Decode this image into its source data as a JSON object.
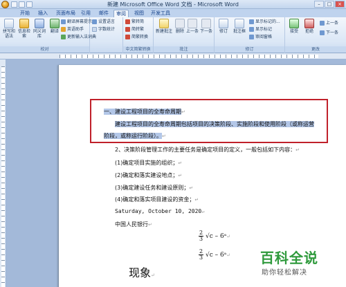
{
  "window": {
    "title": "新建 Microsoft Office Word 文档 - Microsoft Word",
    "min": "–",
    "max": "□",
    "close": "×"
  },
  "tabs": [
    "开始",
    "插入",
    "页面布局",
    "引用",
    "邮件",
    "审阅",
    "视图",
    "开发工具"
  ],
  "active_tab": "审阅",
  "ribbon": {
    "proofing": {
      "label": "校对",
      "spelling": "拼写和语法",
      "research": "信息检索",
      "thesaurus": "同义词库",
      "translate": "翻译",
      "small": [
        "翻译屏幕提示",
        "英语助手",
        "更新输入法词典"
      ]
    },
    "wordcount": {
      "small": [
        "设置语言",
        "字数统计"
      ]
    },
    "chinese": {
      "label": "中文简繁转换",
      "small": [
        "繁转简",
        "简转繁",
        "简繁转换"
      ]
    },
    "comments": {
      "label": "批注",
      "new": "新建批注",
      "delete": "删除",
      "prev": "上一条",
      "next": "下一条"
    },
    "tracking": {
      "label": "修订",
      "track": "修订",
      "balloons": "批注框",
      "markup": "显示标记的...",
      "show": "显示标记",
      "pane": "审阅窗格"
    },
    "changes": {
      "label": "更改",
      "accept": "接受",
      "reject": "拒绝",
      "prev": "上一条",
      "next": "下一条"
    }
  },
  "document": {
    "line1": "一、建设工程项目的全寿命周期",
    "line2": "建设工程项目的全寿命周期包括项目的决策阶段、实施阶段和使用阶段（或称运营",
    "line3": "阶段，或称运行阶段）。",
    "line4": "2、决策阶段管理工作的主要任务是确定项目的定义，一般包括如下内容：",
    "item1": "(1)确定项目实施的组织；",
    "item2": "(2)确定和落实建设地点；",
    "item3": "(3)确定建设任务和建设原则；",
    "item4": "(4)确定和落实项目建设的资金；",
    "date": "Saturday, October 10, 2020",
    "bank": "中国人民银行",
    "formula_num": "2",
    "formula_den": "3",
    "formula_expr": "√c – 6ᵃ",
    "big": "现象",
    "para_mark": "↵"
  },
  "watermark": {
    "title": "百科全说",
    "subtitle": "助你轻松解决"
  }
}
